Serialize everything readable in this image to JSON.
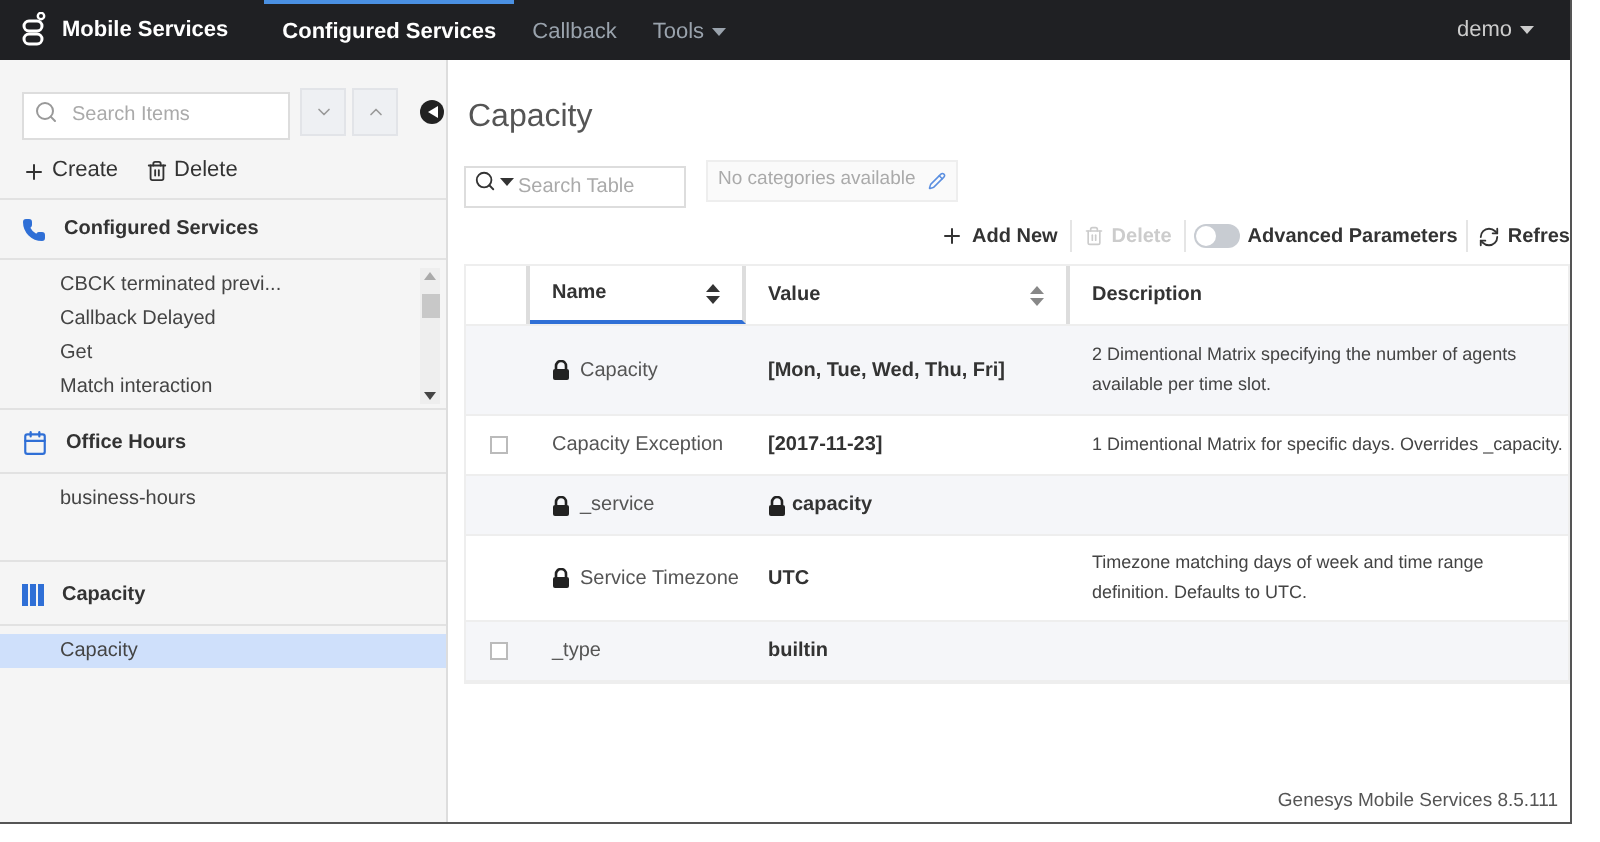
{
  "navbar": {
    "brand": "Mobile Services",
    "tabs": [
      {
        "label": "Configured Services",
        "selected": true,
        "dropdown": false
      },
      {
        "label": "Callback",
        "selected": false,
        "dropdown": false
      },
      {
        "label": "Tools",
        "selected": false,
        "dropdown": true
      }
    ],
    "user": "demo"
  },
  "sidebar": {
    "search": {
      "placeholder": "Search Items"
    },
    "actions": [
      "Create",
      "Delete"
    ],
    "sections": [
      {
        "title": "Configured Services",
        "items": [
          {
            "label": "CBCK terminated previ...",
            "selected": false
          },
          {
            "label": "Callback Delayed",
            "selected": false
          },
          {
            "label": "Get",
            "selected": false
          },
          {
            "label": "Match interaction",
            "selected": false
          }
        ]
      },
      {
        "title": "Office Hours",
        "items": [
          {
            "label": "business-hours",
            "selected": false
          }
        ]
      },
      {
        "title": "Capacity",
        "items": [
          {
            "label": "Capacity",
            "selected": true
          }
        ]
      }
    ]
  },
  "main": {
    "title": "Capacity",
    "search": {
      "placeholder": "Search Table"
    },
    "categories": "No categories available",
    "toolbar": {
      "add": "Add New",
      "delete": "Delete",
      "advanced": {
        "label": "Advanced Parameters",
        "on": false
      },
      "refresh": "Refres"
    },
    "table": {
      "columns": [
        {
          "label": "Name",
          "sortable": true,
          "sorted": true
        },
        {
          "label": "Value",
          "sortable": true,
          "sorted": false
        },
        {
          "label": "Description",
          "sortable": false,
          "sorted": false
        }
      ],
      "rows": [
        {
          "name": "Capacity",
          "locked": true,
          "value": "[Mon, Tue, Wed, Thu, Fri]",
          "value_locked": false,
          "description": "2 Dimentional Matrix specifying the number of agents available per time slot."
        },
        {
          "name": "Capacity Exception",
          "locked": false,
          "checked": false,
          "value": "[2017-11-23]",
          "value_locked": false,
          "description": "1 Dimentional Matrix for specific days. Overrides _capacity."
        },
        {
          "name": "_service",
          "locked": true,
          "value": "capacity",
          "value_locked": true
        },
        {
          "name": "Service Timezone",
          "locked": true,
          "value": "UTC",
          "value_locked": false,
          "description": "Timezone matching days of week and time range definition. Defaults to UTC."
        },
        {
          "name": "_type",
          "locked": false,
          "checked": false,
          "value": "builtin",
          "value_locked": false
        }
      ]
    }
  },
  "footer": "Genesys Mobile Services 8.5.111"
}
